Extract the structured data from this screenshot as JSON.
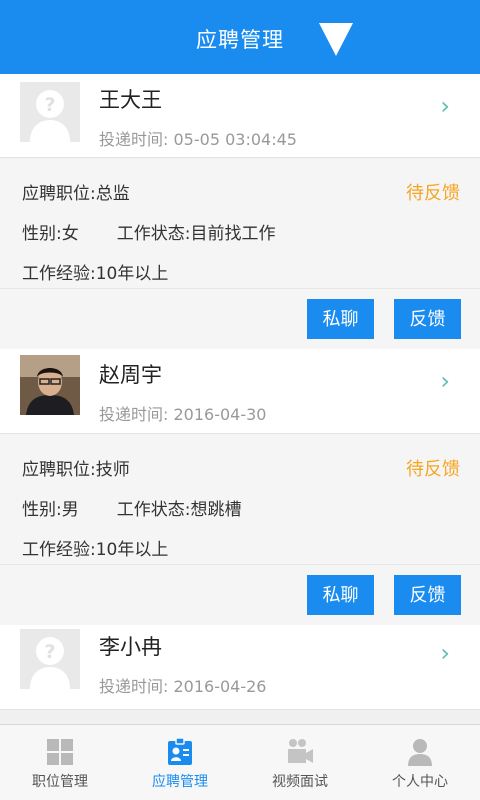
{
  "header": {
    "title": "应聘管理"
  },
  "applicants": [
    {
      "name": "王大王",
      "time_label": "投递时间:",
      "time": "05-05 03:04:45",
      "position_label": "应聘职位:",
      "position": "总监",
      "status": "待反馈",
      "gender_label": "性别:",
      "gender": "女",
      "work_status_label": "工作状态:",
      "work_status": "目前找工作",
      "experience_label": "工作经验:",
      "experience": "10年以上",
      "chat_label": "私聊",
      "feedback_label": "反馈",
      "avatar": "placeholder"
    },
    {
      "name": "赵周宇",
      "time_label": "投递时间:",
      "time": "2016-04-30",
      "position_label": "应聘职位:",
      "position": "技师",
      "status": "待反馈",
      "gender_label": "性别:",
      "gender": "男",
      "work_status_label": "工作状态:",
      "work_status": "想跳槽",
      "experience_label": "工作经验:",
      "experience": "10年以上",
      "chat_label": "私聊",
      "feedback_label": "反馈",
      "avatar": "photo"
    },
    {
      "name": "李小冉",
      "time_label": "投递时间:",
      "time": "2016-04-26",
      "avatar": "placeholder"
    }
  ],
  "tabs": [
    {
      "label": "职位管理",
      "icon": "grid-icon"
    },
    {
      "label": "应聘管理",
      "icon": "id-card-icon"
    },
    {
      "label": "视频面试",
      "icon": "video-camera-icon"
    },
    {
      "label": "个人中心",
      "icon": "person-icon"
    }
  ],
  "colors": {
    "primary": "#1a8cf0",
    "status": "#f5a623",
    "chevron": "#5cbfae"
  }
}
